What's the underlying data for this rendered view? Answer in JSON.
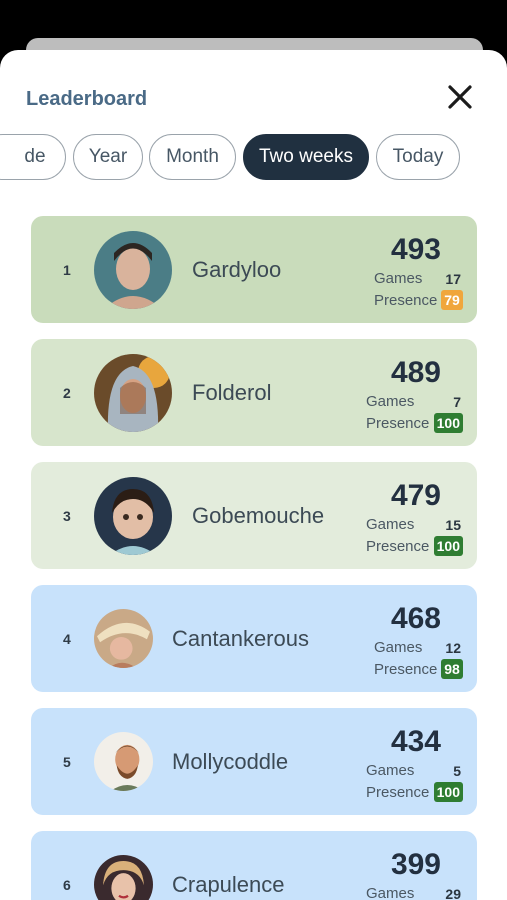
{
  "header": {
    "title": "Leaderboard",
    "close_icon": "close-icon"
  },
  "filters": [
    {
      "label": "de",
      "active": false
    },
    {
      "label": "Year",
      "active": false
    },
    {
      "label": "Month",
      "active": false
    },
    {
      "label": "Two weeks",
      "active": true
    },
    {
      "label": "Today",
      "active": false
    }
  ],
  "labels": {
    "games": "Games",
    "presence": "Presence"
  },
  "colors": {
    "row_gold": "#c9dcbb",
    "row_silver": "#d7e5cc",
    "row_bronze": "#e3ecdc",
    "row_other": "#c8e2fb",
    "badge_high": "#2f7d32",
    "badge_mid": "#f0a63c"
  },
  "players": [
    {
      "rank": "1",
      "name": "Gardyloo",
      "score": "493",
      "games": "17",
      "presence": "79"
    },
    {
      "rank": "2",
      "name": "Folderol",
      "score": "489",
      "games": "7",
      "presence": "100"
    },
    {
      "rank": "3",
      "name": "Gobemouche",
      "score": "479",
      "games": "15",
      "presence": "100"
    },
    {
      "rank": "4",
      "name": "Cantankerous",
      "score": "468",
      "games": "12",
      "presence": "98"
    },
    {
      "rank": "5",
      "name": "Mollycoddle",
      "score": "434",
      "games": "5",
      "presence": "100"
    },
    {
      "rank": "6",
      "name": "Crapulence",
      "score": "399",
      "games": "29",
      "presence": ""
    }
  ]
}
